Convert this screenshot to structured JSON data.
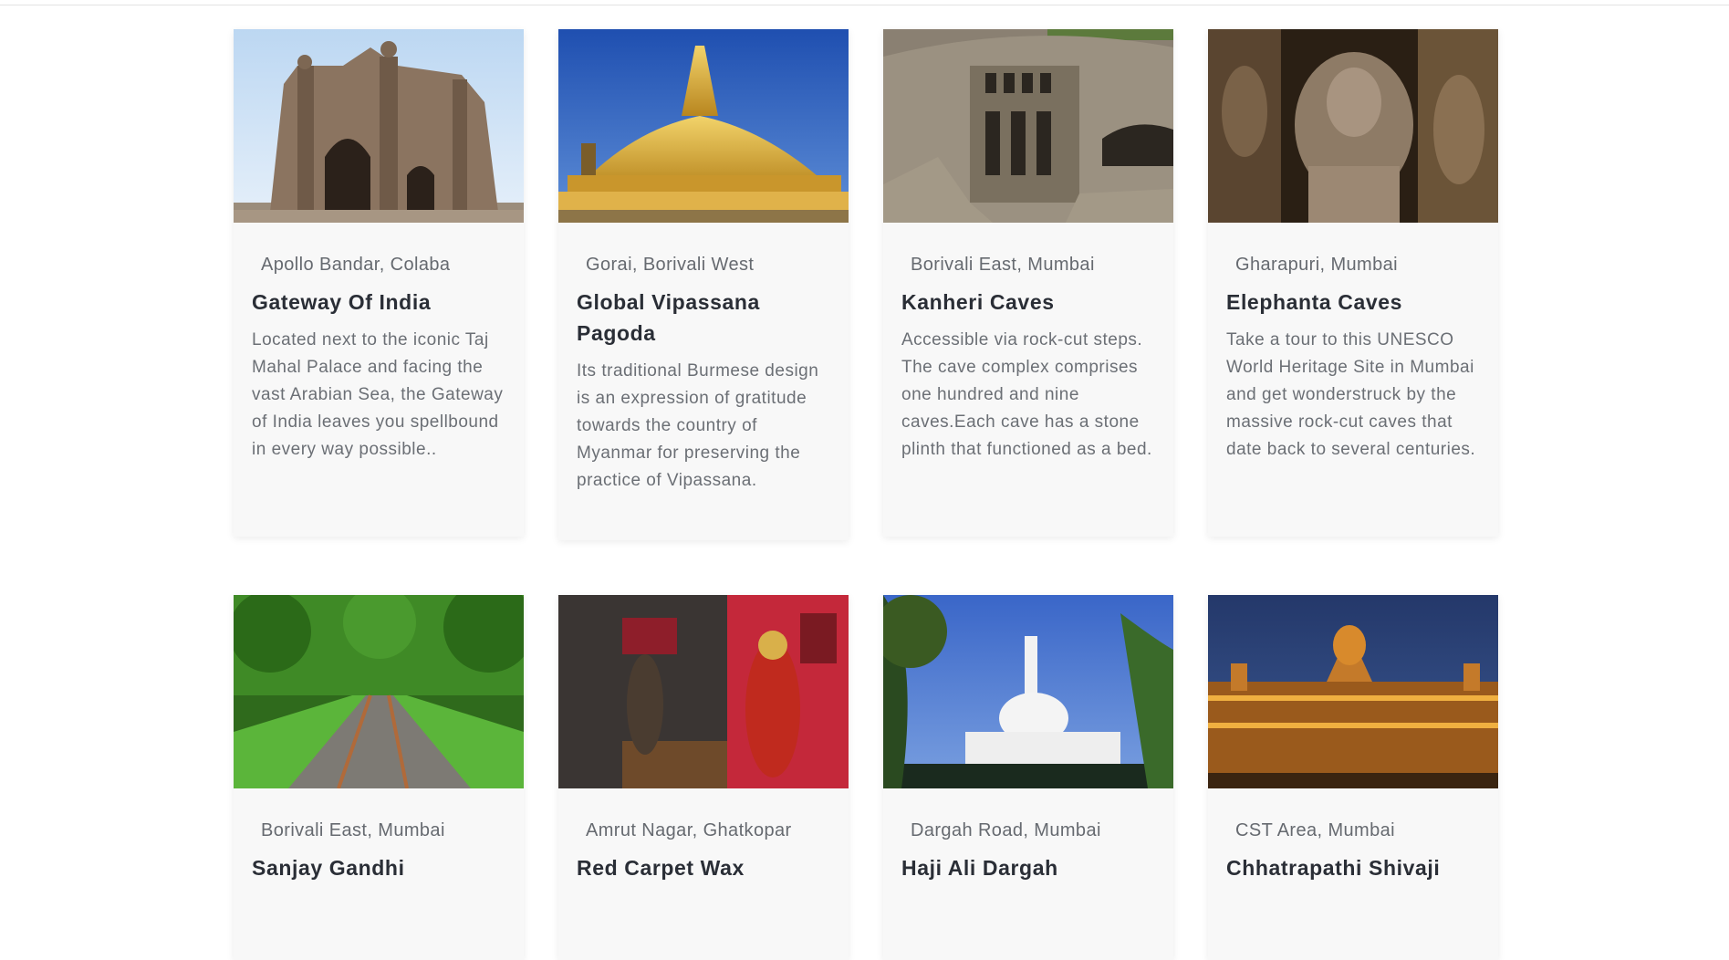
{
  "cards": [
    {
      "location": "Apollo Bandar, Colaba",
      "title": "Gateway Of India",
      "description": "Located next to the iconic Taj Mahal Palace and facing the vast Arabian Sea, the Gateway of India leaves you spellbound in every way possible..",
      "image": "gateway-of-india-photo"
    },
    {
      "location": "Gorai, Borivali West",
      "title": "Global Vipassana Pagoda",
      "description": "Its traditional Burmese design is an expression of gratitude towards the country of Myanmar for preserving the practice of Vipassana.",
      "image": "golden-pagoda-photo"
    },
    {
      "location": "Borivali East, Mumbai",
      "title": "Kanheri Caves",
      "description": "Accessible via rock-cut steps. The cave complex comprises one hundred and nine caves.Each cave has a stone plinth that functioned as a bed.",
      "image": "rock-cut-caves-photo"
    },
    {
      "location": "Gharapuri, Mumbai",
      "title": "Elephanta Caves",
      "description": "Take a tour to this UNESCO World Heritage Site in Mumbai and get wonderstruck by the massive rock-cut caves that date back to several centuries.",
      "image": "stone-sculpture-photo"
    },
    {
      "location": "Borivali East, Mumbai",
      "title": "Sanjay Gandhi",
      "description": "",
      "image": "forest-railway-track-photo"
    },
    {
      "location": "Amrut Nagar, Ghatkopar",
      "title": "Red Carpet Wax",
      "description": "",
      "image": "wax-museum-photo"
    },
    {
      "location": "Dargah Road, Mumbai",
      "title": "Haji Ali Dargah",
      "description": "",
      "image": "white-mosque-photo"
    },
    {
      "location": "CST Area, Mumbai",
      "title": "Chhatrapathi Shivaji",
      "description": "",
      "image": "illuminated-station-photo"
    }
  ]
}
